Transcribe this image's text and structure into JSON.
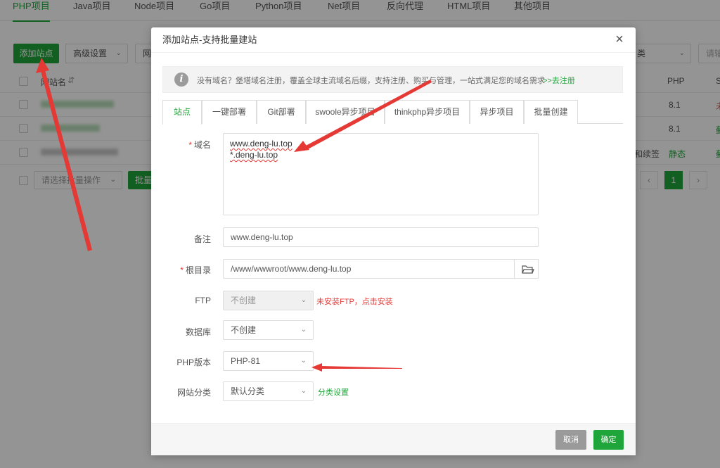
{
  "top_tabs": [
    "PHP项目",
    "Java项目",
    "Node项目",
    "Go项目",
    "Python项目",
    "Net项目",
    "反向代理",
    "HTML项目",
    "其他项目"
  ],
  "bg": {
    "add_site_button": "添加站点",
    "advanced_settings": "高级设置",
    "next_select_partial": "网",
    "right_select_partial": "类",
    "search_partial": "请输",
    "col_site_name": "网站名",
    "col_php": "PHP",
    "col_s_partial": "S",
    "rows": [
      {
        "php": "8.1",
        "status_partial": "未"
      },
      {
        "php": "8.1",
        "status_partial": "蓟"
      },
      {
        "php": "静态",
        "extra": "和续签",
        "status_partial": "蓟"
      }
    ],
    "batch_select": "请选择批量操作",
    "batch_button_partial": "批量",
    "pager": {
      "prev": "‹",
      "current": "1",
      "next": "›"
    }
  },
  "modal": {
    "title": "添加站点-支持批量建站",
    "close": "×",
    "notice": {
      "icon": "i",
      "text": "没有域名？堡塔域名注册，覆盖全球主流域名后缀，支持注册、购买与管理，一站式满足您的域名需求",
      "link": ">>去注册"
    },
    "tabs": [
      "站点",
      "一键部署",
      "Git部署",
      "swoole异步项目",
      "thinkphp异步项目",
      "异步项目",
      "批量创建"
    ],
    "form": {
      "domain_label": "域名",
      "domain_lines": [
        "www.deng-lu.top",
        "*.deng-lu.top"
      ],
      "remark_label": "备注",
      "remark_value": "www.deng-lu.top",
      "root_label": "根目录",
      "root_value": "/www/wwwroot/www.deng-lu.top",
      "ftp_label": "FTP",
      "ftp_value": "不创建",
      "ftp_hint": "未安装FTP，点击安装",
      "db_label": "数据库",
      "db_value": "不创建",
      "php_label": "PHP版本",
      "php_value": "PHP-81",
      "category_label": "网站分类",
      "category_value": "默认分类",
      "category_link": "分类设置"
    },
    "footer": {
      "cancel": "取消",
      "ok": "确定"
    }
  },
  "colors": {
    "accent": "#20a53a",
    "danger": "#e53935",
    "overlay": "rgba(0,0,0,0.42)"
  }
}
